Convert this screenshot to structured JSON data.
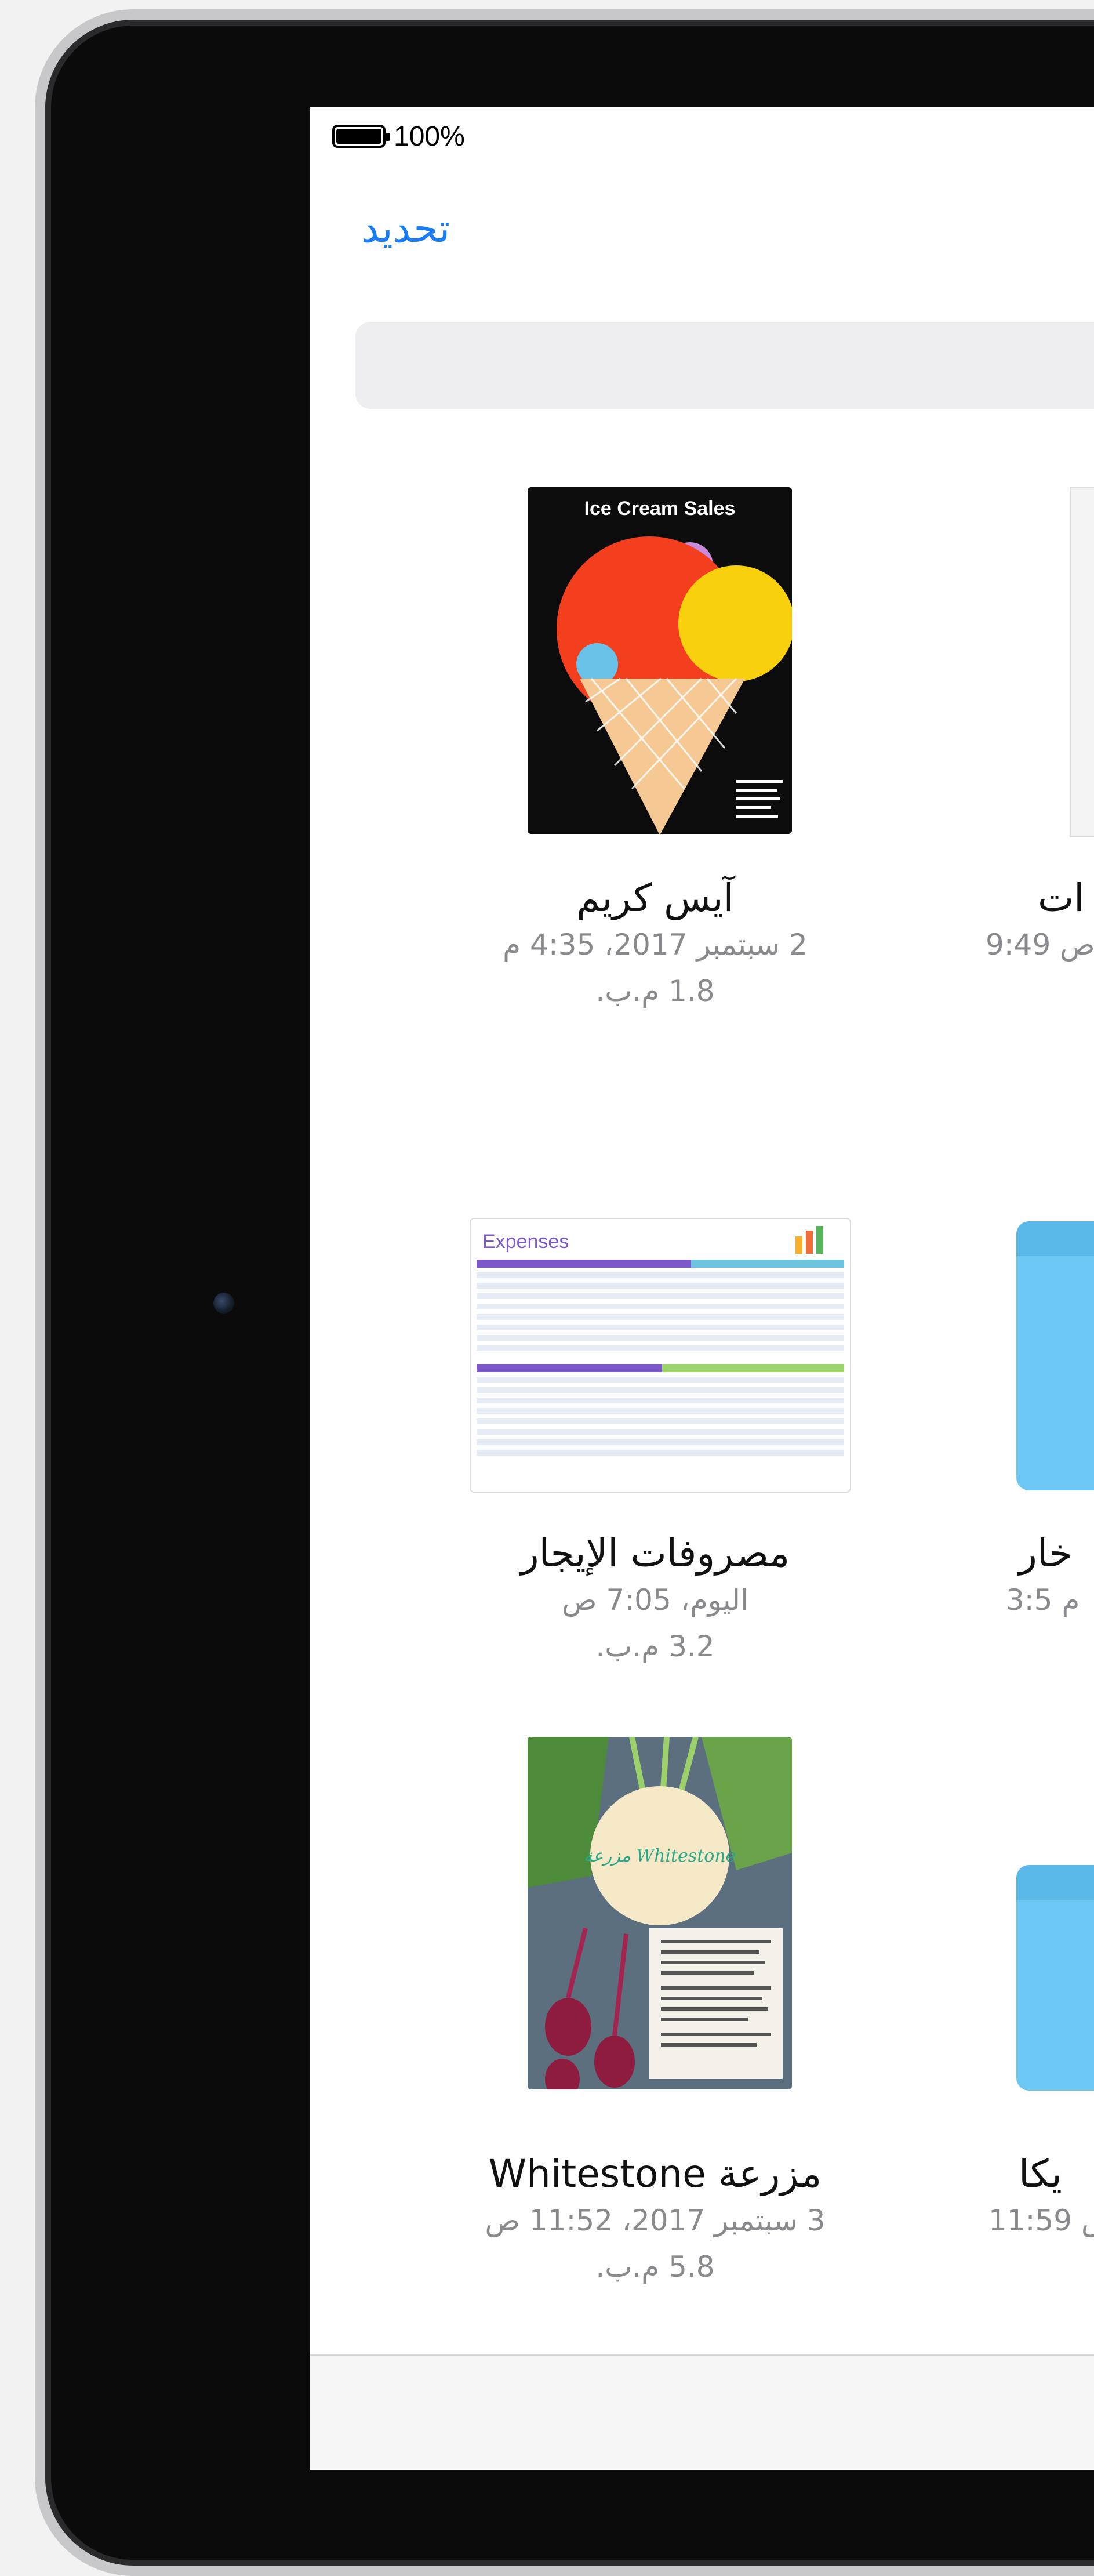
{
  "status": {
    "battery_text": "100%"
  },
  "nav": {
    "edit_label": "تحديد"
  },
  "search": {
    "placeholder": ""
  },
  "files": [
    {
      "name": "آيس كريم",
      "date": "2 سبتمبر 2017، 4:35 م",
      "size": "1.8 م.ب.",
      "thumb_title": "Ice Cream Sales"
    },
    {
      "name": "مصروفات الإيجار",
      "date": "اليوم، 7:05 ص",
      "size": "3.2 م.ب.",
      "thumb_title": "Expenses"
    },
    {
      "name": "مزرعة Whitestone",
      "date": "3 سبتمبر 2017، 11:52 ص",
      "size": "5.8 م.ب.",
      "thumb_title": "مزرعة Whitestone"
    }
  ],
  "partial_right": [
    {
      "name_fragment": "ات",
      "date_fragment": "9:49 ص"
    },
    {
      "name_fragment": "خار",
      "date_fragment": "3:5 م"
    },
    {
      "name_fragment": "يكا",
      "date_fragment": "11:59 ص"
    }
  ],
  "colors": {
    "accent": "#1a7cf5",
    "folder": "#6cc8f2",
    "device_frame": "#0b0b0b",
    "secondary_text": "#8a8a8e"
  },
  "icons": {
    "battery": "battery-icon",
    "camera": "camera-icon"
  }
}
